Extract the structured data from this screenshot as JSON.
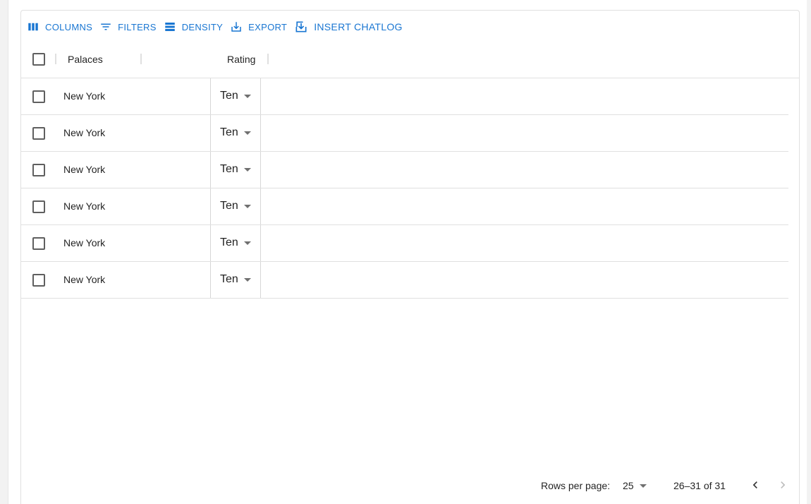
{
  "toolbar": {
    "columns_label": "Columns",
    "filters_label": "Filters",
    "density_label": "Density",
    "export_label": "Export",
    "insert_chatlog_label": "Insert Chatlog"
  },
  "table": {
    "columns": [
      {
        "header": "Palaces"
      },
      {
        "header": "Rating"
      }
    ],
    "rows": [
      {
        "palace": "New York",
        "rating": "Ten"
      },
      {
        "palace": "New York",
        "rating": "Ten"
      },
      {
        "palace": "New York",
        "rating": "Ten"
      },
      {
        "palace": "New York",
        "rating": "Ten"
      },
      {
        "palace": "New York",
        "rating": "Ten"
      },
      {
        "palace": "New York",
        "rating": "Ten"
      }
    ]
  },
  "footer": {
    "rows_per_page_label": "Rows per page:",
    "rows_per_page_value": "25",
    "range_text": "26–31 of 31"
  },
  "icons": {
    "columns": "view-column-icon",
    "filters": "filter-list-icon",
    "density": "density-icon",
    "export": "download-icon",
    "insert_chatlog": "save-alt-icon",
    "prev": "chevron-left-icon",
    "next": "chevron-right-icon"
  },
  "colors": {
    "accent": "#1976d2",
    "border": "#e0e0e0",
    "disabled": "#bdbdbd"
  }
}
